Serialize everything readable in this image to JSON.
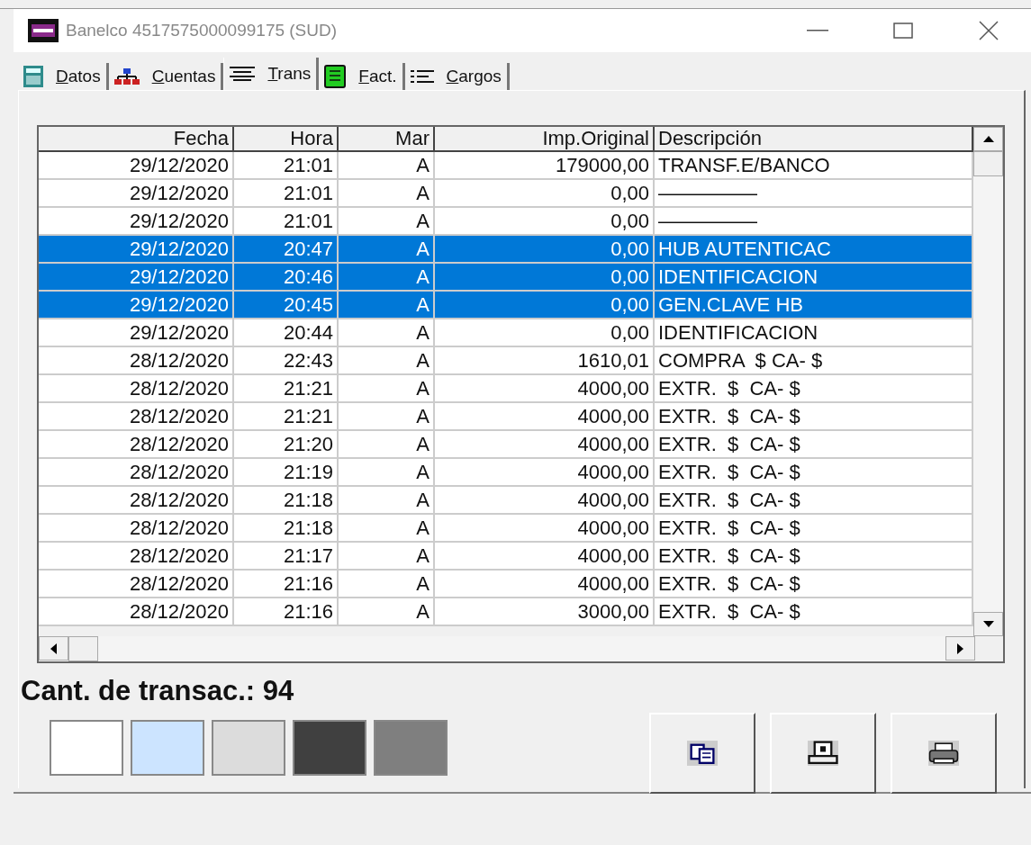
{
  "window": {
    "title": "Banelco 4517575000099175 (SUD)"
  },
  "tabs": [
    {
      "label": "Datos",
      "selected": false
    },
    {
      "label": "Cuentas",
      "selected": false
    },
    {
      "label": "Trans",
      "selected": true
    },
    {
      "label": "Fact.",
      "selected": false
    },
    {
      "label": "Cargos",
      "selected": false
    }
  ],
  "table": {
    "columns": [
      "Fecha",
      "Hora",
      "Mar",
      "Imp.Original",
      "Descripción"
    ],
    "rows": [
      {
        "cells": [
          "29/12/2020",
          "21:01",
          "A",
          "179000,00",
          "TRANSF.E/BANCO"
        ],
        "selected": false
      },
      {
        "cells": [
          "29/12/2020",
          "21:01",
          "A",
          "0,00",
          "—————"
        ],
        "selected": false
      },
      {
        "cells": [
          "29/12/2020",
          "21:01",
          "A",
          "0,00",
          "—————"
        ],
        "selected": false
      },
      {
        "cells": [
          "29/12/2020",
          "20:47",
          "A",
          "0,00",
          "HUB AUTENTICAC"
        ],
        "selected": true
      },
      {
        "cells": [
          "29/12/2020",
          "20:46",
          "A",
          "0,00",
          "IDENTIFICACION"
        ],
        "selected": true
      },
      {
        "cells": [
          "29/12/2020",
          "20:45",
          "A",
          "0,00",
          "GEN.CLAVE HB"
        ],
        "selected": true
      },
      {
        "cells": [
          "29/12/2020",
          "20:44",
          "A",
          "0,00",
          "IDENTIFICACION"
        ],
        "selected": false
      },
      {
        "cells": [
          "28/12/2020",
          "22:43",
          "A",
          "1610,01",
          "COMPRA  $ CA- $"
        ],
        "selected": false
      },
      {
        "cells": [
          "28/12/2020",
          "21:21",
          "A",
          "4000,00",
          "EXTR.  $  CA- $"
        ],
        "selected": false
      },
      {
        "cells": [
          "28/12/2020",
          "21:21",
          "A",
          "4000,00",
          "EXTR.  $  CA- $"
        ],
        "selected": false
      },
      {
        "cells": [
          "28/12/2020",
          "21:20",
          "A",
          "4000,00",
          "EXTR.  $  CA- $"
        ],
        "selected": false
      },
      {
        "cells": [
          "28/12/2020",
          "21:19",
          "A",
          "4000,00",
          "EXTR.  $  CA- $"
        ],
        "selected": false
      },
      {
        "cells": [
          "28/12/2020",
          "21:18",
          "A",
          "4000,00",
          "EXTR.  $  CA- $"
        ],
        "selected": false
      },
      {
        "cells": [
          "28/12/2020",
          "21:18",
          "A",
          "4000,00",
          "EXTR.  $  CA- $"
        ],
        "selected": false
      },
      {
        "cells": [
          "28/12/2020",
          "21:17",
          "A",
          "4000,00",
          "EXTR.  $  CA- $"
        ],
        "selected": false
      },
      {
        "cells": [
          "28/12/2020",
          "21:16",
          "A",
          "4000,00",
          "EXTR.  $  CA- $"
        ],
        "selected": false
      },
      {
        "cells": [
          "28/12/2020",
          "21:16",
          "A",
          "3000,00",
          "EXTR.  $  CA- $"
        ],
        "selected": false
      }
    ]
  },
  "count_label": "Cant. de transac.: 94",
  "swatches": [
    {
      "color": "#ffffff"
    },
    {
      "color": "#cce4ff"
    },
    {
      "color": "#dcdcdc"
    },
    {
      "color": "#404040"
    },
    {
      "color": "#7f7f7f"
    }
  ],
  "buttons": [
    {
      "kind": "copy"
    },
    {
      "kind": "card"
    },
    {
      "kind": "print"
    }
  ]
}
